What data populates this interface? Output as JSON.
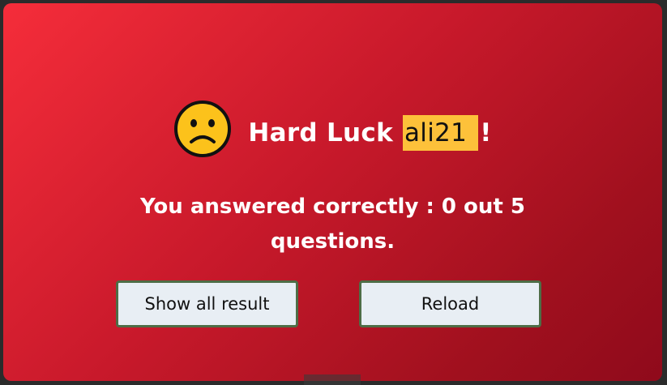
{
  "result": {
    "title_prefix": "Hard Luck",
    "username": "ali21",
    "title_suffix": "!",
    "emoji_icon": "sad-face-icon",
    "message": "You answered correctly : 0 out 5 questions."
  },
  "buttons": {
    "show_all_label": "Show all result",
    "reload_label": "Reload"
  },
  "colors": {
    "card_gradient_start": "#f52d3a",
    "card_gradient_end": "#8f0a1b",
    "username_highlight": "#fdc13a",
    "button_bg": "#e8eef4",
    "button_border": "#4e6d46"
  }
}
